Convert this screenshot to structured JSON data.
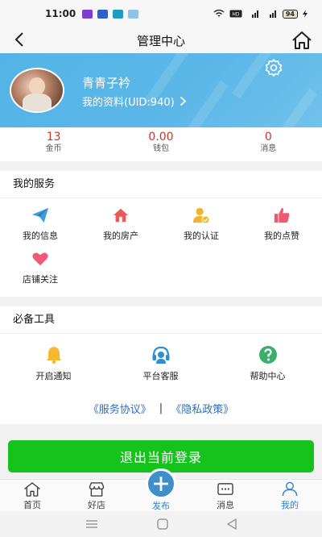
{
  "status_bar": {
    "time": "11:00",
    "battery": "94"
  },
  "header": {
    "title": "管理中心"
  },
  "profile": {
    "username": "青青子衿",
    "link_text": "我的资料(UID:940)"
  },
  "stats": [
    {
      "value": "13",
      "label": "金币"
    },
    {
      "value": "0.00",
      "label": "钱包"
    },
    {
      "value": "0",
      "label": "消息"
    }
  ],
  "services": {
    "title": "我的服务",
    "items": [
      {
        "label": "我的信息",
        "icon": "paper-plane-icon"
      },
      {
        "label": "我的房产",
        "icon": "house-icon"
      },
      {
        "label": "我的认证",
        "icon": "user-verified-icon"
      },
      {
        "label": "我的点赞",
        "icon": "thumbs-up-icon"
      },
      {
        "label": "店铺关注",
        "icon": "heart-icon"
      }
    ]
  },
  "tools": {
    "title": "必备工具",
    "items": [
      {
        "label": "开启通知",
        "icon": "bell-icon"
      },
      {
        "label": "平台客服",
        "icon": "headset-icon"
      },
      {
        "label": "帮助中心",
        "icon": "question-icon"
      }
    ]
  },
  "agreements": {
    "service": "《服务协议》",
    "separator": "|",
    "privacy": "《隐私政策》"
  },
  "logout_label": "退出当前登录",
  "tabbar": [
    {
      "label": "首页",
      "icon": "home-icon"
    },
    {
      "label": "好店",
      "icon": "shop-icon"
    },
    {
      "label": "发布",
      "icon": "plus-icon"
    },
    {
      "label": "消息",
      "icon": "message-icon"
    },
    {
      "label": "我的",
      "icon": "person-icon"
    }
  ],
  "colors": {
    "accent": "#5cb7e8",
    "logout": "#16c21c",
    "stat": "#c0392b",
    "link": "#2f6fb5",
    "active_tab": "#2f80c8"
  }
}
